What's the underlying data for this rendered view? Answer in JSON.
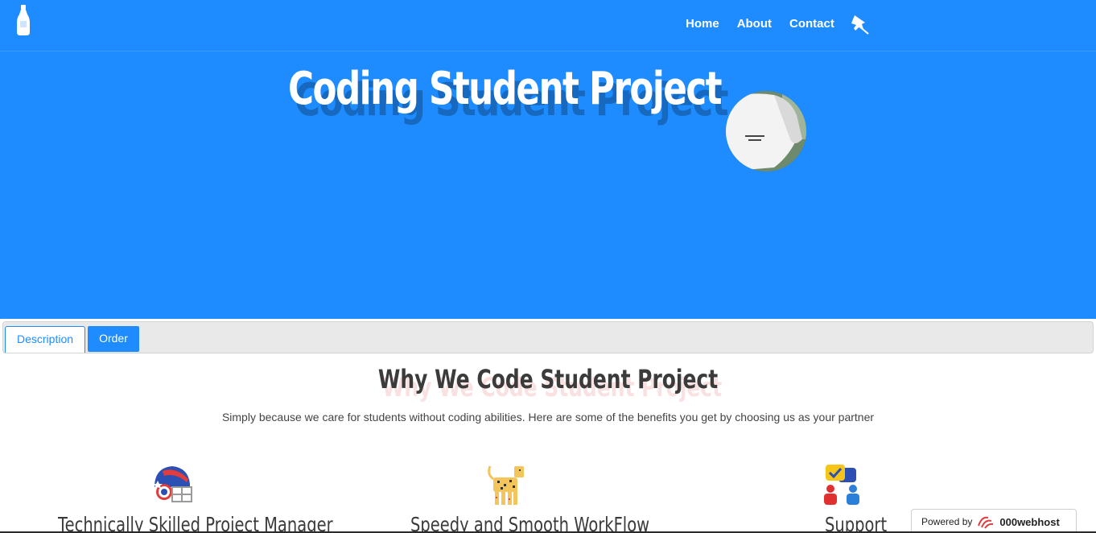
{
  "nav": {
    "links": [
      "Home",
      "About",
      "Contact"
    ]
  },
  "hero": {
    "title": "Coding Student Project"
  },
  "tabs": {
    "description": "Description",
    "order": "Order"
  },
  "section": {
    "title": "Why We Code Student Project",
    "subtitle": "Simply because we care for students without coding abilities. Here are some of the benefits you get by choosing us as your partner"
  },
  "features": [
    {
      "title": "Technically Skilled Project Manager",
      "icon": "helmet-icon"
    },
    {
      "title": "Speedy and Smooth WorkFlow",
      "icon": "cheetah-icon"
    },
    {
      "title": "Support",
      "icon": "support-chat-icon"
    }
  ],
  "badge": {
    "powered_by": "Powered by",
    "brand": "000webhost"
  },
  "colors": {
    "primary": "#1e8cff",
    "text_dark": "#3b3b3b"
  }
}
